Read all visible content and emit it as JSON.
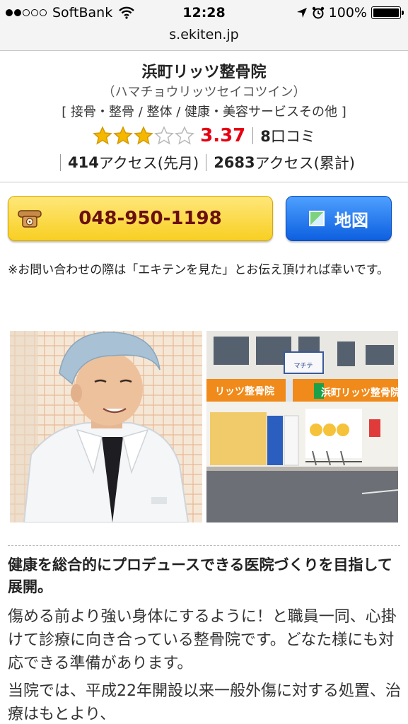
{
  "status_bar": {
    "carrier": "SoftBank",
    "time": "12:28",
    "battery": "100%",
    "signal_bars": 2,
    "icons": [
      "wifi-icon",
      "location-arrow-icon",
      "alarm-clock-icon",
      "battery-icon"
    ]
  },
  "url_bar": {
    "domain": "s.ekiten.jp"
  },
  "shop": {
    "name": "浜町リッツ整骨院",
    "kana": "（ハマチョウリッツセイコツイン）",
    "categories": "[ 接骨・整骨 / 整体 / 健康・美容サービスその他 ]",
    "rating": {
      "stars_filled": 3,
      "stars_total": 5,
      "score": "3.37"
    },
    "reviews_count": "8",
    "reviews_label": "口コミ",
    "access_last_month": "414",
    "access_last_month_label": "アクセス(先月)",
    "access_total": "2683",
    "access_total_label": "アクセス(累計)"
  },
  "buttons": {
    "tel_number": "048-950-1198",
    "map_label": "地図"
  },
  "notice": "※お問い合わせの際は「エキテンを見た」とお伝え頂ければ幸いです。",
  "photos": {
    "photo1_name": "staff-photo",
    "photo2_name": "clinic-exterior-photo",
    "storefront_sign": "浜町リッツ整骨院",
    "storefront_sign_left": "リッツ整骨院",
    "bldg_sign": "マチテ"
  },
  "description": {
    "title": "健康を総合的にプロデュースできる医院づくりを目指して展開。",
    "body": "傷める前より強い身体にするように！と職員一同、心掛けて診療に向き合っている整骨院です。どなた様にも対応できる準備があります。",
    "body2": "当院では、平成22年開設以来一般外傷に対する処置、治療はもとより、"
  },
  "colors": {
    "tel_button": "#f8cf22",
    "map_button": "#0d5fe0",
    "score": "#e60012",
    "star": "#f5b800"
  }
}
